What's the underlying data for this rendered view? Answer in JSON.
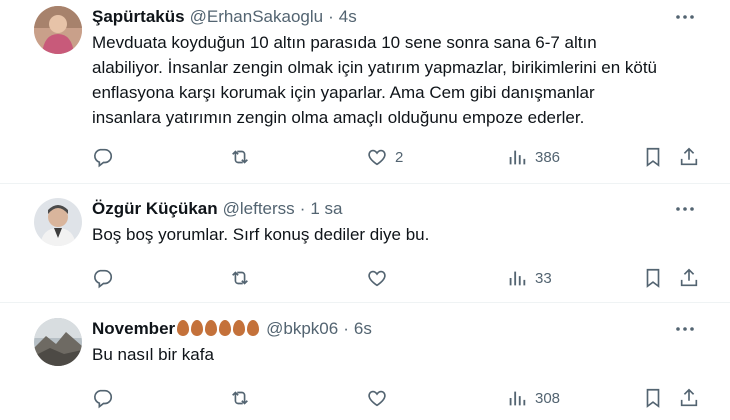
{
  "tweets": [
    {
      "name": "Şapürtaküs",
      "handle": "@ErhanSakaoglu",
      "dot": "·",
      "time": "4s",
      "text_lines": [
        "Mevduata koyduğun 10 altın parasıda 10 sene sonra sana 6-7 altın",
        "alabiliyor. İnsanlar zengin olmak için yatırım yapmazlar, birikimlerini en kötü",
        "enflasyona karşı korumak için yaparlar. Ama Cem gibi danışmanlar",
        "insanlara yatırımın zengin olma amaçlı olduğunu empoze ederler."
      ],
      "likes": "2",
      "views": "386"
    },
    {
      "name": "Özgür Küçükan",
      "handle": "@lefterss",
      "dot": "·",
      "time": "1 sa",
      "text_lines": [
        "Boş boş yorumlar. Sırf konuş dediler diye bu."
      ],
      "likes": "",
      "views": "33"
    },
    {
      "name": "November",
      "name_emojis": "🍂🍂🍂🍂🍂🍂",
      "handle": "@bkpk06",
      "dot": "·",
      "time": "6s",
      "text_lines": [
        "Bu nasıl bir kafa"
      ],
      "likes": "",
      "views": "308"
    }
  ],
  "icons": {
    "reply": "reply-icon",
    "retweet": "retweet-icon",
    "like": "heart-icon",
    "views": "views-icon",
    "bookmark": "bookmark-icon",
    "share": "share-icon",
    "more": "more-icon"
  },
  "colors": {
    "text": "#0f1419",
    "secondary": "#536471",
    "divider": "#eff3f4"
  }
}
